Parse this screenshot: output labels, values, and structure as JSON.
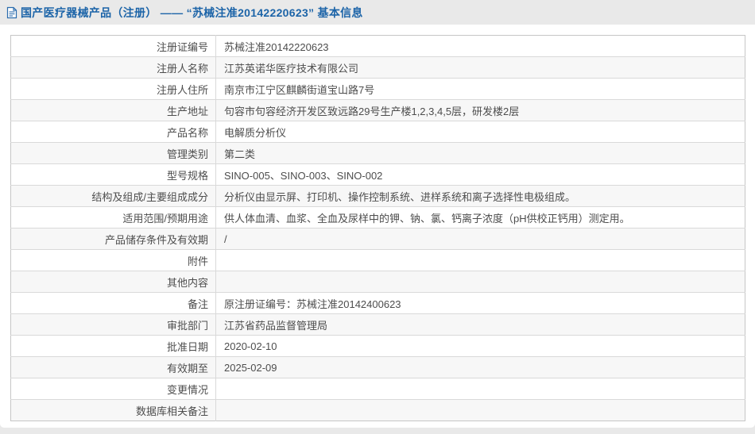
{
  "page": {
    "title": "国产医疗器械产品（注册） ——  “苏械注准20142220623”  基本信息"
  },
  "icons": {
    "header_icon": "document-icon"
  },
  "colors": {
    "title_blue": "#1c64a8",
    "page_background": "#e9e9e9",
    "card_background": "#ffffff",
    "row_alt_background": "#f7f7f7",
    "table_border": "#d9d9d9",
    "text": "#4d4d4d"
  },
  "table": {
    "rows": [
      {
        "label": "注册证编号",
        "value": "苏械注准20142220623"
      },
      {
        "label": "注册人名称",
        "value": "江苏英诺华医疗技术有限公司"
      },
      {
        "label": "注册人住所",
        "value": "南京市江宁区麒麟街道宝山路7号"
      },
      {
        "label": "生产地址",
        "value": "句容市句容经济开发区致远路29号生产楼1,2,3,4,5层，研发楼2层"
      },
      {
        "label": "产品名称",
        "value": "电解质分析仪"
      },
      {
        "label": "管理类别",
        "value": "第二类"
      },
      {
        "label": "型号规格",
        "value": "SINO-005、SINO-003、SINO-002"
      },
      {
        "label": "结构及组成/主要组成成分",
        "value": "分析仪由显示屏、打印机、操作控制系统、进样系统和离子选择性电极组成。"
      },
      {
        "label": "适用范围/预期用途",
        "value": "供人体血清、血浆、全血及尿样中的钾、钠、氯、钙离子浓度（pH供校正钙用）测定用。"
      },
      {
        "label": "产品储存条件及有效期",
        "value": "/"
      },
      {
        "label": "附件",
        "value": ""
      },
      {
        "label": "其他内容",
        "value": ""
      },
      {
        "label": "备注",
        "value": "原注册证编号：苏械注准20142400623"
      },
      {
        "label": "审批部门",
        "value": "江苏省药品监督管理局"
      },
      {
        "label": "批准日期",
        "value": "2020-02-10"
      },
      {
        "label": "有效期至",
        "value": "2025-02-09"
      },
      {
        "label": "变更情况",
        "value": ""
      },
      {
        "label": "数据库相关备注",
        "value": ""
      }
    ]
  }
}
